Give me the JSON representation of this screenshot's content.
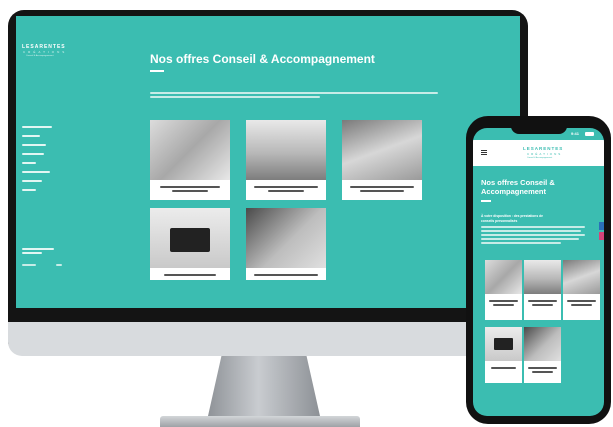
{
  "site": {
    "logo_title": "LESARENTES",
    "logo_sub": "CRÉATIONS",
    "logo_tagline": "Conseil & Accompagnement",
    "page_title": "Nos offres Conseil & Accompagnement",
    "mobile_title_line1": "Nos offres Conseil &",
    "mobile_title_line2": "Accompagnement",
    "mobile_intro_lead": "À votre disposition : des prestations de",
    "mobile_intro_lead2": "conseils personnalisés",
    "colors": {
      "brand_teal": "#3bbdb1",
      "text_white": "#ffffff",
      "accent_blue": "#2a6fb8",
      "accent_pink": "#d6447a"
    }
  },
  "status_bar": {
    "time": "9:41"
  },
  "icons": {
    "menu": "hamburger-menu-icon",
    "signal": "signal-icon",
    "battery": "battery-icon",
    "social_linkedin": "linkedin-icon",
    "social_instagram": "instagram-icon"
  }
}
